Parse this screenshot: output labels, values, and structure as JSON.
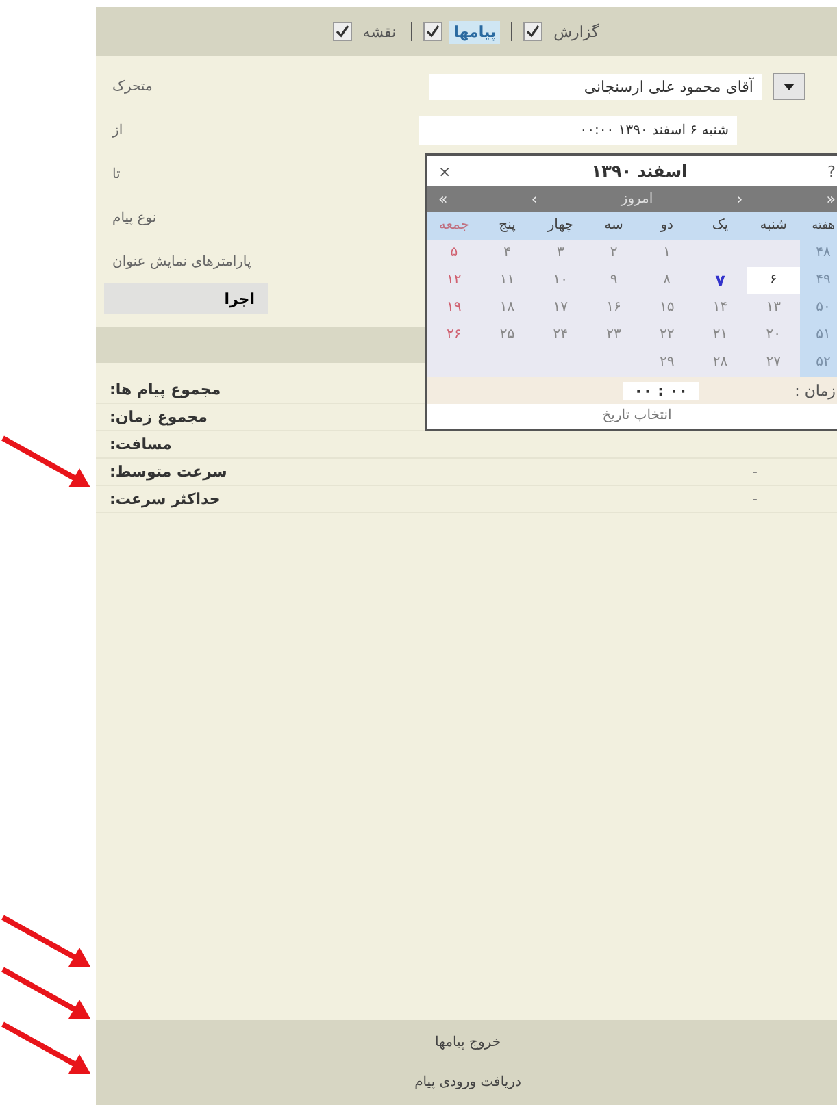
{
  "tabs": [
    {
      "label": "گزارش",
      "checked": true,
      "selected": false
    },
    {
      "label": "پیامها",
      "checked": true,
      "selected": true
    },
    {
      "label": "نقشه",
      "checked": true,
      "selected": false
    }
  ],
  "form": {
    "fields": [
      {
        "label": "متحرک",
        "kind": "select",
        "value": "آقای محمود علی ارسنجانی"
      },
      {
        "label": "از",
        "kind": "date",
        "value": "شنبه ۶ اسفند ۱۳۹۰ ۰۰:۰۰"
      },
      {
        "label": "تا",
        "kind": "plain"
      },
      {
        "label": "نوع پیام",
        "kind": "plain"
      },
      {
        "label": "پارامترهای نمایش عنوان",
        "kind": "plain"
      }
    ],
    "run_button": "اجرا"
  },
  "stats": [
    {
      "label": "مجموع پیام ها:"
    },
    {
      "label": "مجموع زمان:"
    },
    {
      "label": "مسافت:"
    },
    {
      "label": "سرعت متوسط:",
      "value": "-"
    },
    {
      "label": "حداکثر سرعت:",
      "value": "-"
    }
  ],
  "calendar": {
    "help": "?",
    "title": "اسفند ۱۳۹۰",
    "close": "×",
    "nav": [
      "«",
      "‹",
      "امروز",
      "›",
      "»"
    ],
    "weekdays": [
      "هفته",
      "شنبه",
      "یک",
      "دو",
      "سه",
      "چهار",
      "پنج",
      "جمعه"
    ],
    "weeks": [
      {
        "week": "۴۸",
        "days": [
          {
            "kind": "blank"
          },
          {
            "kind": "blank"
          },
          {
            "kind": "day",
            "text": "۱",
            "selected": false,
            "today": false,
            "holiday": false
          },
          {
            "kind": "day",
            "text": "۲",
            "selected": false,
            "today": false,
            "holiday": false
          },
          {
            "kind": "day",
            "text": "۳",
            "selected": false,
            "today": false,
            "holiday": false
          },
          {
            "kind": "day",
            "text": "۴",
            "selected": false,
            "today": false,
            "holiday": false
          },
          {
            "kind": "day",
            "text": "۵",
            "selected": false,
            "today": false,
            "holiday": true
          }
        ]
      },
      {
        "week": "۴۹",
        "days": [
          {
            "kind": "day",
            "text": "۶",
            "selected": true,
            "today": false,
            "holiday": false
          },
          {
            "kind": "day",
            "text": "۷",
            "selected": false,
            "today": true,
            "holiday": false
          },
          {
            "kind": "day",
            "text": "۸",
            "selected": false,
            "today": false,
            "holiday": false
          },
          {
            "kind": "day",
            "text": "۹",
            "selected": false,
            "today": false,
            "holiday": false
          },
          {
            "kind": "day",
            "text": "۱۰",
            "selected": false,
            "today": false,
            "holiday": false
          },
          {
            "kind": "day",
            "text": "۱۱",
            "selected": false,
            "today": false,
            "holiday": false
          },
          {
            "kind": "day",
            "text": "۱۲",
            "selected": false,
            "today": false,
            "holiday": true
          }
        ]
      },
      {
        "week": "۵۰",
        "days": [
          {
            "kind": "day",
            "text": "۱۳",
            "selected": false,
            "today": false,
            "holiday": false
          },
          {
            "kind": "day",
            "text": "۱۴",
            "selected": false,
            "today": false,
            "holiday": false
          },
          {
            "kind": "day",
            "text": "۱۵",
            "selected": false,
            "today": false,
            "holiday": false
          },
          {
            "kind": "day",
            "text": "۱۶",
            "selected": false,
            "today": false,
            "holiday": false
          },
          {
            "kind": "day",
            "text": "۱۷",
            "selected": false,
            "today": false,
            "holiday": false
          },
          {
            "kind": "day",
            "text": "۱۸",
            "selected": false,
            "today": false,
            "holiday": false
          },
          {
            "kind": "day",
            "text": "۱۹",
            "selected": false,
            "today": false,
            "holiday": true
          }
        ]
      },
      {
        "week": "۵۱",
        "days": [
          {
            "kind": "day",
            "text": "۲۰",
            "selected": false,
            "today": false,
            "holiday": false
          },
          {
            "kind": "day",
            "text": "۲۱",
            "selected": false,
            "today": false,
            "holiday": false
          },
          {
            "kind": "day",
            "text": "۲۲",
            "selected": false,
            "today": false,
            "holiday": false
          },
          {
            "kind": "day",
            "text": "۲۳",
            "selected": false,
            "today": false,
            "holiday": false
          },
          {
            "kind": "day",
            "text": "۲۴",
            "selected": false,
            "today": false,
            "holiday": false
          },
          {
            "kind": "day",
            "text": "۲۵",
            "selected": false,
            "today": false,
            "holiday": false
          },
          {
            "kind": "day",
            "text": "۲۶",
            "selected": false,
            "today": false,
            "holiday": true
          }
        ]
      },
      {
        "week": "۵۲",
        "days": [
          {
            "kind": "day",
            "text": "۲۷",
            "selected": false,
            "today": false,
            "holiday": false
          },
          {
            "kind": "day",
            "text": "۲۸",
            "selected": false,
            "today": false,
            "holiday": false
          },
          {
            "kind": "day",
            "text": "۲۹",
            "selected": false,
            "today": false,
            "holiday": false
          }
        ]
      }
    ],
    "time_label": "زمان :",
    "time_hours": "۰۰",
    "time_sep": ":",
    "time_minutes": "۰۰",
    "footer": "انتخاب تاریخ"
  },
  "footer_links": [
    "خروج پیامها",
    "دریافت ورودی پیام"
  ]
}
